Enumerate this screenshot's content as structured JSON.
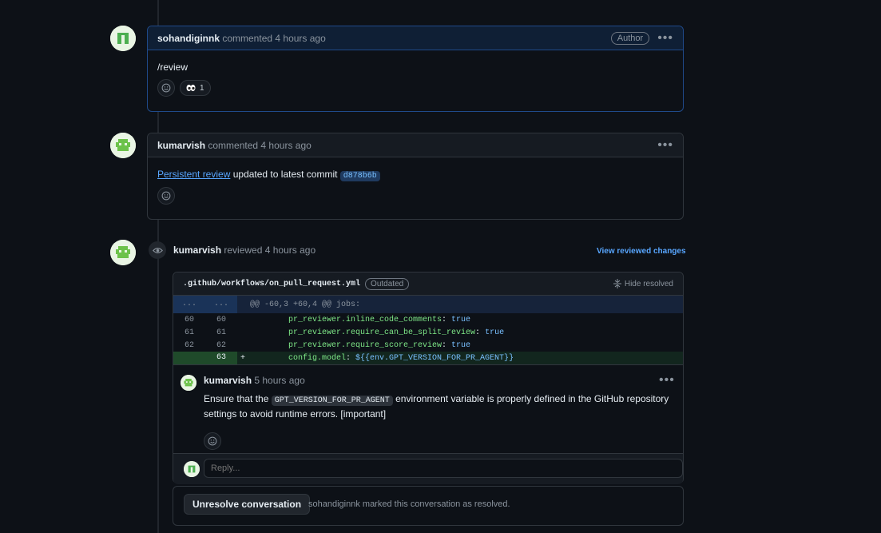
{
  "comments": [
    {
      "user": "sohandiginnk",
      "action": "commented",
      "time": "4 hours ago",
      "badge": "Author",
      "body": "/review",
      "reaction": {
        "emoji_icon": "eyes-icon",
        "count": "1"
      }
    },
    {
      "user": "kumarvish",
      "action": "commented",
      "time": "4 hours ago",
      "link_text": "Persistent review",
      "body_rest": "updated to latest commit",
      "commit_sha": "d878b6b"
    }
  ],
  "review": {
    "user": "kumarvish",
    "action": "reviewed",
    "time": "4 hours ago",
    "view_changes_label": "View reviewed changes",
    "file": {
      "name": ".github/workflows/on_pull_request.yml",
      "status": "Outdated",
      "hide_resolved_label": "Hide resolved",
      "hunk": {
        "left": "...",
        "right": "...",
        "header": "@@ -60,3 +60,4 @@ jobs:"
      },
      "lines": [
        {
          "old": "60",
          "new": "60",
          "sign": "",
          "key": "pr_reviewer.inline_code_comments",
          "sep": ": ",
          "val": "true"
        },
        {
          "old": "61",
          "new": "61",
          "sign": "",
          "key": "pr_reviewer.require_can_be_split_review",
          "sep": ": ",
          "val": "true"
        },
        {
          "old": "62",
          "new": "62",
          "sign": "",
          "key": "pr_reviewer.require_score_review",
          "sep": ": ",
          "val": "true"
        },
        {
          "old": "",
          "new": "63",
          "sign": "+",
          "key": "config.model",
          "sep": ": ",
          "val": "${{env.GPT_VERSION_FOR_PR_AGENT}}"
        }
      ]
    },
    "inline_comment": {
      "user": "kumarvish",
      "time": "5 hours ago",
      "text_before": "Ensure that the",
      "code": "GPT_VERSION_FOR_PR_AGENT",
      "text_after": "environment variable is properly defined in the GitHub repository settings to avoid runtime errors. [important]"
    },
    "reply_placeholder": "Reply...",
    "unresolve_label": "Unresolve conversation",
    "resolved_by": "sohandiginnk",
    "resolved_text": "marked this conversation as resolved."
  },
  "colors": {
    "accent": "#58a6ff",
    "added_line": "#12261e",
    "author_border": "#1f4a8a"
  }
}
